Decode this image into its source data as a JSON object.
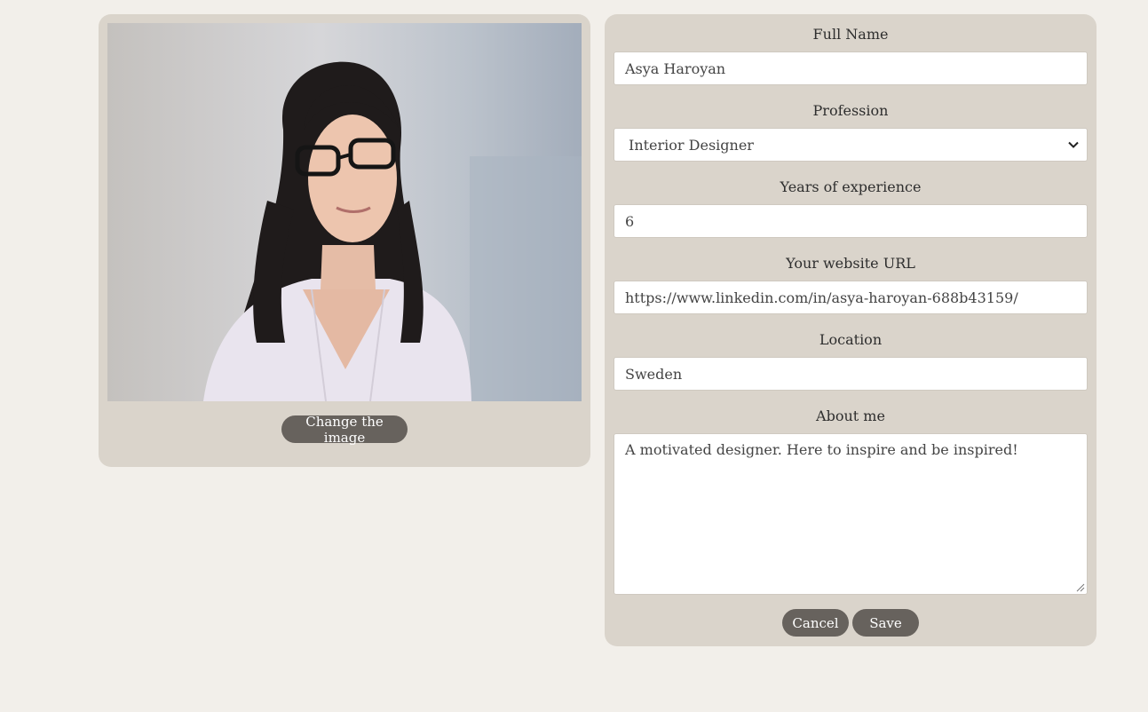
{
  "image_panel": {
    "photo_alt": "profile-photo",
    "change_image_label": "Change the image"
  },
  "form": {
    "full_name": {
      "label": "Full Name",
      "value": "Asya Haroyan"
    },
    "profession": {
      "label": "Profession",
      "selected": "Interior Designer"
    },
    "experience": {
      "label": "Years of experience",
      "value": "6"
    },
    "website": {
      "label": "Your website URL",
      "value": "https://www.linkedin.com/in/asya-haroyan-688b43159/"
    },
    "location": {
      "label": "Location",
      "value": "Sweden"
    },
    "about": {
      "label": "About me",
      "value": "A motivated designer. Here to inspire and be inspired!"
    },
    "cancel_label": "Cancel",
    "save_label": "Save"
  },
  "colors": {
    "page_background": "#f2efea",
    "card_background": "#dad4cb",
    "button_background": "#67625d",
    "button_text": "#ffffff"
  },
  "icons": {
    "select_arrow": "chevron-down-icon",
    "textarea_resize": "resize-handle-icon"
  }
}
